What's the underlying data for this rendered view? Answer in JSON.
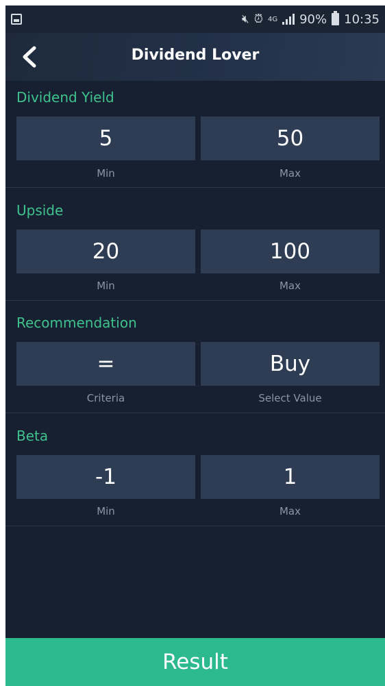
{
  "status_bar": {
    "time": "10:35",
    "battery": "90%",
    "network": "4G",
    "icons": [
      "gallery-icon",
      "mute-icon",
      "alarm-icon",
      "network-4g-icon",
      "signal-icon",
      "battery-icon"
    ]
  },
  "header": {
    "title": "Dividend Lover",
    "back_icon": "chevron-left-icon"
  },
  "sections": [
    {
      "label": "Dividend Yield",
      "left_value": "5",
      "right_value": "50",
      "left_caption": "Min",
      "right_caption": "Max"
    },
    {
      "label": "Upside",
      "left_value": "20",
      "right_value": "100",
      "left_caption": "Min",
      "right_caption": "Max"
    },
    {
      "label": "Recommendation",
      "left_value": "=",
      "right_value": "Buy",
      "left_caption": "Criteria",
      "right_caption": "Select Value"
    },
    {
      "label": "Beta",
      "left_value": "-1",
      "right_value": "1",
      "left_caption": "Min",
      "right_caption": "Max"
    }
  ],
  "footer": {
    "result_label": "Result"
  },
  "colors": {
    "background": "#162030",
    "field": "#2e3d54",
    "accent": "#3fc28e",
    "button": "#2bb98d",
    "caption": "#8b95a3"
  }
}
